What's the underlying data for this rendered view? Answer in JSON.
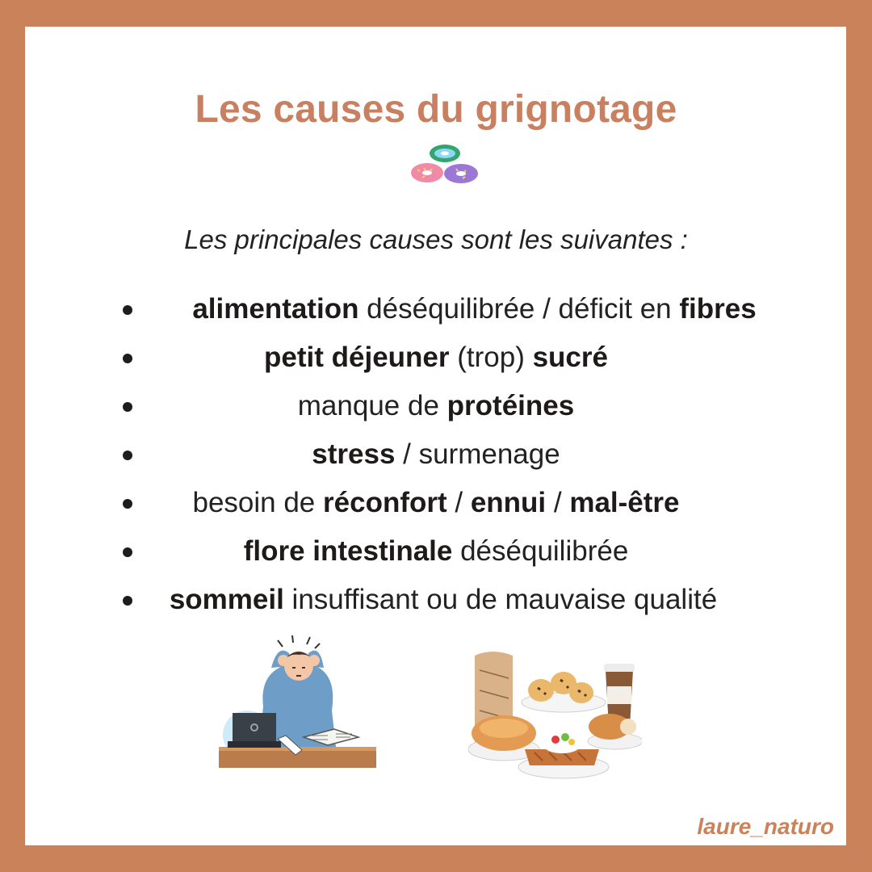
{
  "title": "Les causes du grignotage",
  "subtitle": "Les principales causes sont les suivantes :",
  "causes": [
    [
      {
        "t": "alimentation",
        "b": true
      },
      {
        "t": " déséquilibrée / déficit en ",
        "b": false
      },
      {
        "t": "fibres",
        "b": true
      }
    ],
    [
      {
        "t": "petit déjeuner",
        "b": true
      },
      {
        "t": " (trop) ",
        "b": false
      },
      {
        "t": "sucré",
        "b": true
      }
    ],
    [
      {
        "t": "manque de ",
        "b": false
      },
      {
        "t": "protéines",
        "b": true
      }
    ],
    [
      {
        "t": "stress",
        "b": true
      },
      {
        "t": " / surmenage",
        "b": false
      }
    ],
    [
      {
        "t": "besoin de ",
        "b": false
      },
      {
        "t": "réconfort",
        "b": true
      },
      {
        "t": " / ",
        "b": false
      },
      {
        "t": "ennui",
        "b": true
      },
      {
        "t": " / ",
        "b": false
      },
      {
        "t": "mal-être",
        "b": true
      }
    ],
    [
      {
        "t": "flore intestinale",
        "b": true
      },
      {
        "t": " déséquilibrée",
        "b": false
      }
    ],
    [
      {
        "t": "sommeil",
        "b": true
      },
      {
        "t": " insuffisant ou de mauvaise qualité",
        "b": false
      }
    ]
  ],
  "handle": "laure_naturo",
  "icons": [
    "donut-icon"
  ],
  "colors": {
    "frame": "#c9825a",
    "title": "#c98060",
    "text": "#222222"
  }
}
